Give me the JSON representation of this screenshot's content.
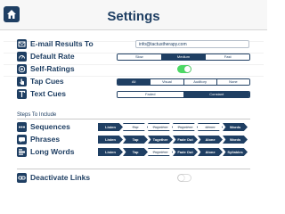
{
  "header": {
    "title": "Settings"
  },
  "settings": {
    "email": {
      "label": "E-mail Results To",
      "value": "info@tactustherapy.com"
    },
    "default_rate": {
      "label": "Default Rate",
      "options": [
        "Slow",
        "Medium",
        "Fast"
      ],
      "selected": "Medium"
    },
    "self_ratings": {
      "label": "Self-Ratings",
      "on": true
    },
    "tap_cues": {
      "label": "Tap Cues",
      "options": [
        "All",
        "Visual",
        "Auditory",
        "None"
      ],
      "selected": "All"
    },
    "text_cues": {
      "label": "Text Cues",
      "options": [
        "Faded",
        "Constant"
      ],
      "selected": "Constant"
    }
  },
  "steps": {
    "title": "Steps To Include",
    "rows": [
      {
        "label": "Sequences",
        "steps": [
          {
            "text": "Listen",
            "on": true
          },
          {
            "text": "Tap",
            "on": false
          },
          {
            "text": "Together",
            "on": false
          },
          {
            "text": "Together",
            "on": false
          },
          {
            "text": "Alone",
            "on": false
          },
          {
            "text": "Words",
            "on": true
          }
        ]
      },
      {
        "label": "Phrases",
        "steps": [
          {
            "text": "Listen",
            "on": true
          },
          {
            "text": "Tap",
            "on": true
          },
          {
            "text": "Together",
            "on": true
          },
          {
            "text": "Fade Out",
            "on": true
          },
          {
            "text": "Alone",
            "on": true
          },
          {
            "text": "Words",
            "on": true
          }
        ]
      },
      {
        "label": "Long Words",
        "steps": [
          {
            "text": "Listen",
            "on": true
          },
          {
            "text": "Tap",
            "on": true
          },
          {
            "text": "Together",
            "on": false
          },
          {
            "text": "Fade Out",
            "on": true
          },
          {
            "text": "Alone",
            "on": true
          },
          {
            "text": "Syllables",
            "on": true
          }
        ]
      }
    ]
  },
  "deactivate_links": {
    "label": "Deactivate Links",
    "on": false
  },
  "colors": {
    "primary": "#1f3f63",
    "toggle_on": "#4cd964"
  }
}
